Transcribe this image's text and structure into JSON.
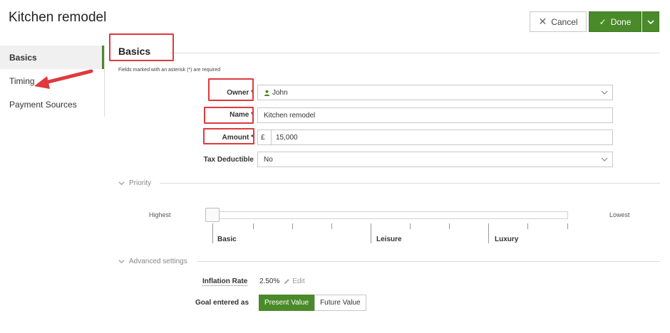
{
  "page": {
    "title": "Kitchen remodel"
  },
  "toolbar": {
    "cancel_label": "Cancel",
    "done_label": "Done"
  },
  "sidebar": {
    "items": [
      {
        "label": "Basics",
        "active": true
      },
      {
        "label": "Timing",
        "active": false
      },
      {
        "label": "Payment Sources",
        "active": false
      }
    ]
  },
  "section": {
    "title": "Basics",
    "required_note": "Fields marked with an asterisk (*) are required"
  },
  "form": {
    "owner": {
      "label": "Owner *",
      "value": "John"
    },
    "name": {
      "label": "Name *",
      "value": "Kitchen remodel"
    },
    "amount": {
      "label": "Amount *",
      "currency": "£",
      "value": "15,000"
    },
    "tax": {
      "label": "Tax Deductible",
      "value": "No"
    }
  },
  "priority": {
    "header": "Priority",
    "low_end": "Highest",
    "high_end": "Lowest",
    "level": 0,
    "categories": [
      "Basic",
      "Leisure",
      "Luxury"
    ]
  },
  "advanced": {
    "header": "Advanced settings",
    "inflation_label": "Inflation Rate",
    "inflation_value": "2.50%",
    "edit_label": "Edit",
    "goal_label": "Goal entered as",
    "toggle_options": [
      "Present Value",
      "Future Value"
    ],
    "toggle_selected": "Present Value"
  },
  "colors": {
    "accent": "#4a8a2a",
    "annotation": "#e0393e"
  }
}
